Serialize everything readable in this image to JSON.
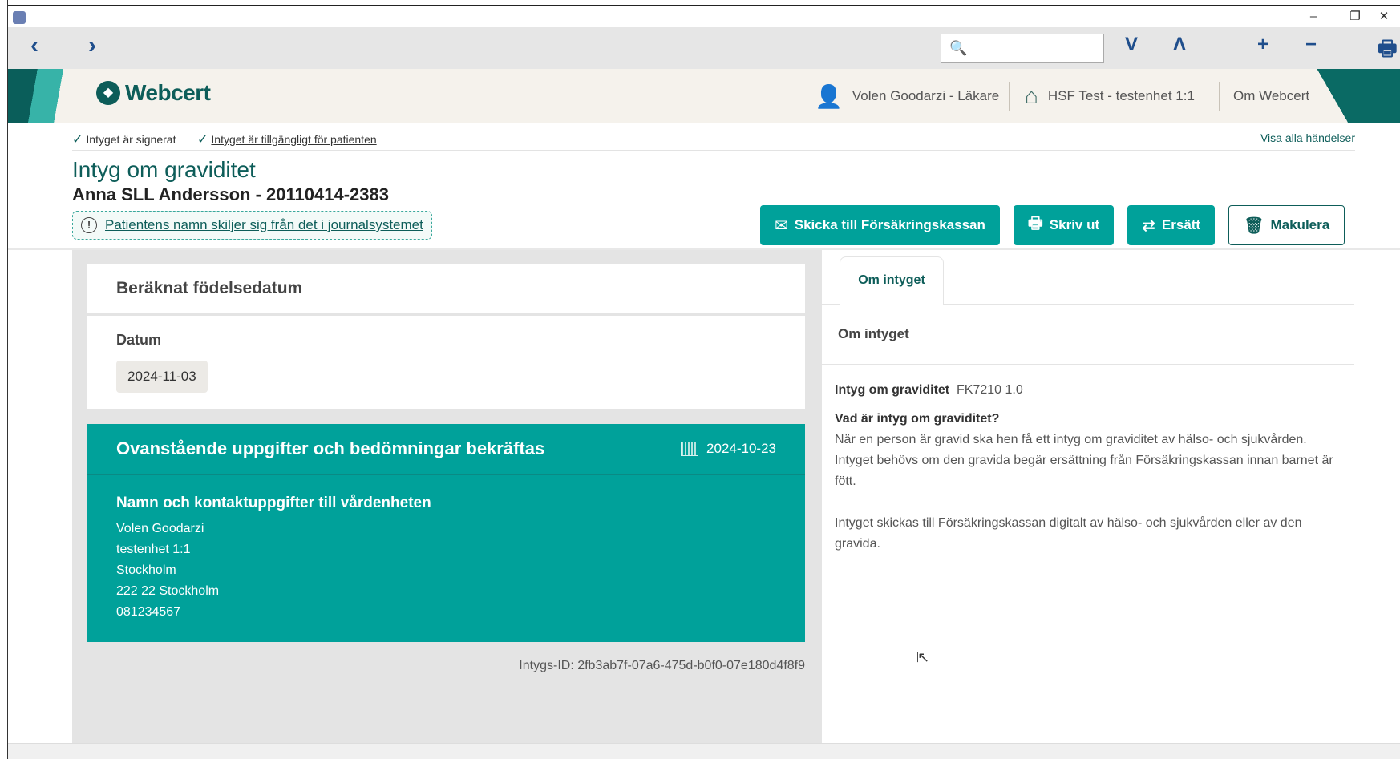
{
  "window": {
    "minimize": "–",
    "restore": "❐",
    "close": "✕"
  },
  "toolbar": {
    "back": "‹",
    "forward": "›",
    "search_placeholder": "",
    "find_next": "V",
    "find_prev": "Λ",
    "zoom_in": "+",
    "zoom_out": "−"
  },
  "header": {
    "brand": "Webcert",
    "user": "Volen Goodarzi - Läkare",
    "unit": "HSF Test - testenhet 1:1",
    "about": "Om Webcert"
  },
  "status": {
    "signed": "Intyget är signerat",
    "available": "Intyget är tillgängligt för patienten",
    "all_events": "Visa alla händelser"
  },
  "document": {
    "title": "Intyg om graviditet",
    "patient": "Anna SLL Andersson - 20110414-2383",
    "warning": "Patientens namn skiljer sig från det i journalsystemet"
  },
  "actions": {
    "send": "Skicka till Försäkringskassan",
    "print": "Skriv ut",
    "replace": "Ersätt",
    "discard": "Makulera"
  },
  "birth": {
    "heading": "Beräknat födelsedatum",
    "label": "Datum",
    "value": "2024-11-03"
  },
  "confirmation": {
    "heading": "Ovanstående uppgifter och bedömningar bekräftas",
    "date": "2024-10-23",
    "subheading": "Namn och kontaktuppgifter till vårdenheten",
    "lines": [
      "Volen Goodarzi",
      "testenhet 1:1",
      "Stockholm",
      "222 22 Stockholm",
      "081234567"
    ]
  },
  "intyg_id": "Intygs-ID: 2fb3ab7f-07a6-475d-b0f0-07e180d4f8f9",
  "side_panel": {
    "tab": "Om intyget",
    "section_title": "Om intyget",
    "cert_name": "Intyg om graviditet",
    "cert_code": "FK7210 1.0",
    "question": "Vad är intyg om graviditet?",
    "para1": "När en person är gravid ska hen få ett intyg om graviditet av hälso- och sjukvården. Intyget behövs om den gravida begär ersättning från Försäkringskassan innan barnet är fött.",
    "para2": "Intyget skickas till Försäkringskassan digitalt av hälso- och sjukvården eller av den gravida."
  }
}
